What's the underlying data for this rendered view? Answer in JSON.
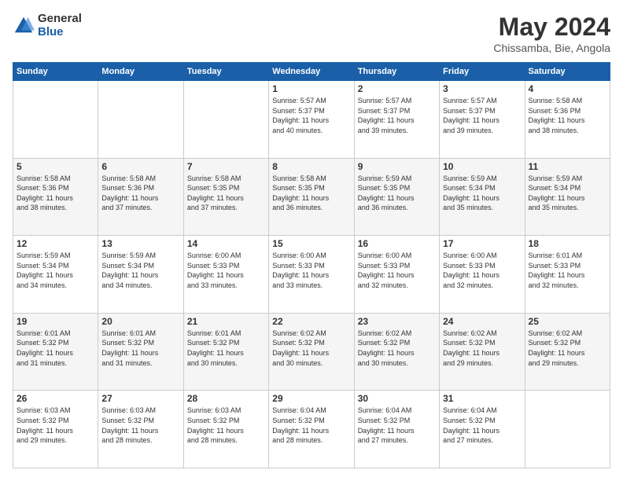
{
  "logo": {
    "general": "General",
    "blue": "Blue"
  },
  "header": {
    "month": "May 2024",
    "location": "Chissamba, Bie, Angola"
  },
  "weekdays": [
    "Sunday",
    "Monday",
    "Tuesday",
    "Wednesday",
    "Thursday",
    "Friday",
    "Saturday"
  ],
  "weeks": [
    [
      {
        "day": "",
        "detail": ""
      },
      {
        "day": "",
        "detail": ""
      },
      {
        "day": "",
        "detail": ""
      },
      {
        "day": "1",
        "detail": "Sunrise: 5:57 AM\nSunset: 5:37 PM\nDaylight: 11 hours\nand 40 minutes."
      },
      {
        "day": "2",
        "detail": "Sunrise: 5:57 AM\nSunset: 5:37 PM\nDaylight: 11 hours\nand 39 minutes."
      },
      {
        "day": "3",
        "detail": "Sunrise: 5:57 AM\nSunset: 5:37 PM\nDaylight: 11 hours\nand 39 minutes."
      },
      {
        "day": "4",
        "detail": "Sunrise: 5:58 AM\nSunset: 5:36 PM\nDaylight: 11 hours\nand 38 minutes."
      }
    ],
    [
      {
        "day": "5",
        "detail": "Sunrise: 5:58 AM\nSunset: 5:36 PM\nDaylight: 11 hours\nand 38 minutes."
      },
      {
        "day": "6",
        "detail": "Sunrise: 5:58 AM\nSunset: 5:36 PM\nDaylight: 11 hours\nand 37 minutes."
      },
      {
        "day": "7",
        "detail": "Sunrise: 5:58 AM\nSunset: 5:35 PM\nDaylight: 11 hours\nand 37 minutes."
      },
      {
        "day": "8",
        "detail": "Sunrise: 5:58 AM\nSunset: 5:35 PM\nDaylight: 11 hours\nand 36 minutes."
      },
      {
        "day": "9",
        "detail": "Sunrise: 5:59 AM\nSunset: 5:35 PM\nDaylight: 11 hours\nand 36 minutes."
      },
      {
        "day": "10",
        "detail": "Sunrise: 5:59 AM\nSunset: 5:34 PM\nDaylight: 11 hours\nand 35 minutes."
      },
      {
        "day": "11",
        "detail": "Sunrise: 5:59 AM\nSunset: 5:34 PM\nDaylight: 11 hours\nand 35 minutes."
      }
    ],
    [
      {
        "day": "12",
        "detail": "Sunrise: 5:59 AM\nSunset: 5:34 PM\nDaylight: 11 hours\nand 34 minutes."
      },
      {
        "day": "13",
        "detail": "Sunrise: 5:59 AM\nSunset: 5:34 PM\nDaylight: 11 hours\nand 34 minutes."
      },
      {
        "day": "14",
        "detail": "Sunrise: 6:00 AM\nSunset: 5:33 PM\nDaylight: 11 hours\nand 33 minutes."
      },
      {
        "day": "15",
        "detail": "Sunrise: 6:00 AM\nSunset: 5:33 PM\nDaylight: 11 hours\nand 33 minutes."
      },
      {
        "day": "16",
        "detail": "Sunrise: 6:00 AM\nSunset: 5:33 PM\nDaylight: 11 hours\nand 32 minutes."
      },
      {
        "day": "17",
        "detail": "Sunrise: 6:00 AM\nSunset: 5:33 PM\nDaylight: 11 hours\nand 32 minutes."
      },
      {
        "day": "18",
        "detail": "Sunrise: 6:01 AM\nSunset: 5:33 PM\nDaylight: 11 hours\nand 32 minutes."
      }
    ],
    [
      {
        "day": "19",
        "detail": "Sunrise: 6:01 AM\nSunset: 5:32 PM\nDaylight: 11 hours\nand 31 minutes."
      },
      {
        "day": "20",
        "detail": "Sunrise: 6:01 AM\nSunset: 5:32 PM\nDaylight: 11 hours\nand 31 minutes."
      },
      {
        "day": "21",
        "detail": "Sunrise: 6:01 AM\nSunset: 5:32 PM\nDaylight: 11 hours\nand 30 minutes."
      },
      {
        "day": "22",
        "detail": "Sunrise: 6:02 AM\nSunset: 5:32 PM\nDaylight: 11 hours\nand 30 minutes."
      },
      {
        "day": "23",
        "detail": "Sunrise: 6:02 AM\nSunset: 5:32 PM\nDaylight: 11 hours\nand 30 minutes."
      },
      {
        "day": "24",
        "detail": "Sunrise: 6:02 AM\nSunset: 5:32 PM\nDaylight: 11 hours\nand 29 minutes."
      },
      {
        "day": "25",
        "detail": "Sunrise: 6:02 AM\nSunset: 5:32 PM\nDaylight: 11 hours\nand 29 minutes."
      }
    ],
    [
      {
        "day": "26",
        "detail": "Sunrise: 6:03 AM\nSunset: 5:32 PM\nDaylight: 11 hours\nand 29 minutes."
      },
      {
        "day": "27",
        "detail": "Sunrise: 6:03 AM\nSunset: 5:32 PM\nDaylight: 11 hours\nand 28 minutes."
      },
      {
        "day": "28",
        "detail": "Sunrise: 6:03 AM\nSunset: 5:32 PM\nDaylight: 11 hours\nand 28 minutes."
      },
      {
        "day": "29",
        "detail": "Sunrise: 6:04 AM\nSunset: 5:32 PM\nDaylight: 11 hours\nand 28 minutes."
      },
      {
        "day": "30",
        "detail": "Sunrise: 6:04 AM\nSunset: 5:32 PM\nDaylight: 11 hours\nand 27 minutes."
      },
      {
        "day": "31",
        "detail": "Sunrise: 6:04 AM\nSunset: 5:32 PM\nDaylight: 11 hours\nand 27 minutes."
      },
      {
        "day": "",
        "detail": ""
      }
    ]
  ]
}
